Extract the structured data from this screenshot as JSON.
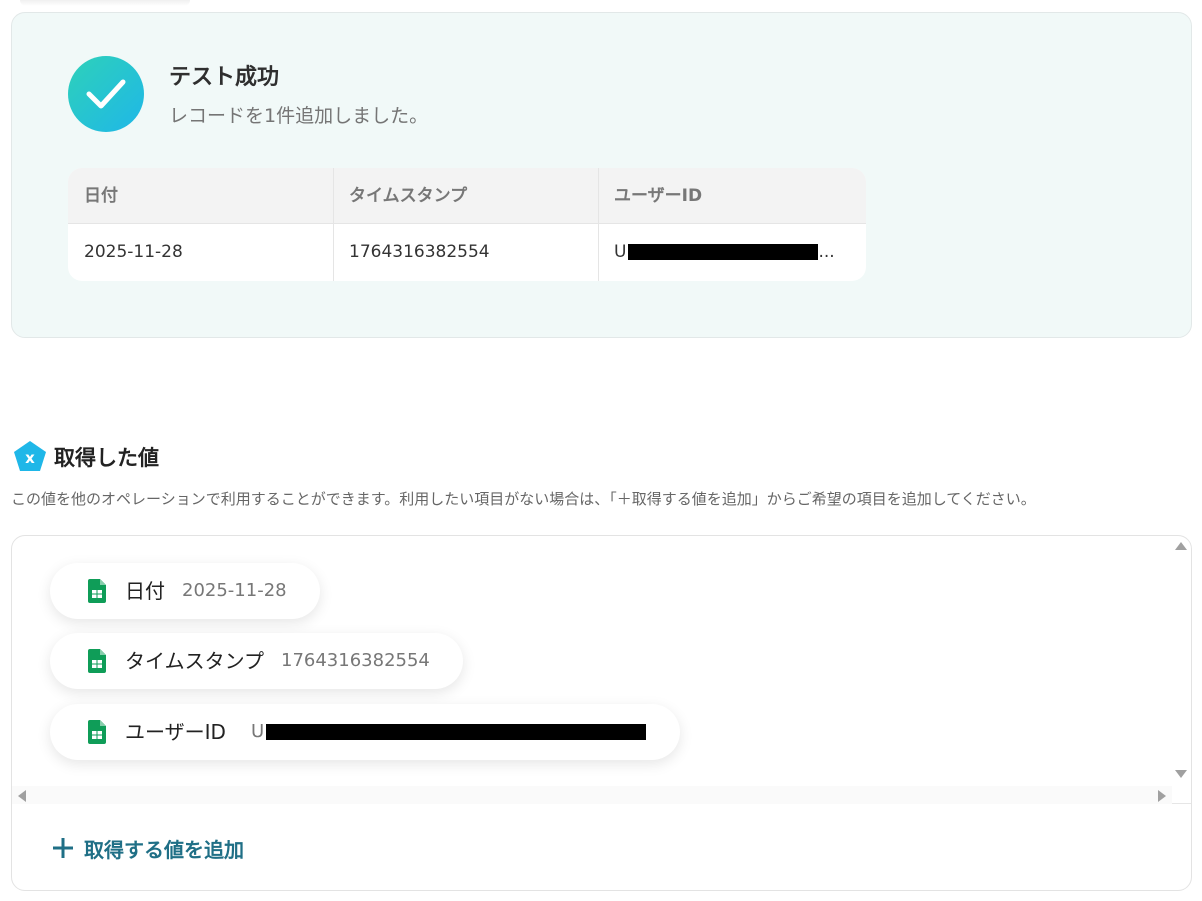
{
  "result": {
    "title": "テスト成功",
    "message": "レコードを1件追加しました。",
    "table": {
      "headers": [
        "日付",
        "タイムスタンプ",
        "ユーザーID"
      ],
      "rows": [
        [
          "2025-11-28",
          "1764316382554",
          "U"
        ]
      ],
      "truncation": "..."
    }
  },
  "section": {
    "title": "取得した値",
    "description": "この値を他のオペレーションで利用することができます。利用したい項目がない場合は、「＋取得する値を追加」からご希望の項目を追加してください。",
    "icon": "x-pentagon-icon"
  },
  "values": [
    {
      "name": "日付",
      "value": "2025-11-28",
      "icon": "google-sheets-icon"
    },
    {
      "name": "タイムスタンプ",
      "value": "1764316382554",
      "icon": "google-sheets-icon"
    },
    {
      "name": "ユーザーID",
      "value": "U",
      "icon": "google-sheets-icon"
    }
  ],
  "add_button": {
    "label": "取得する値を追加"
  },
  "colors": {
    "success_gradient_start": "#2ed1b9",
    "success_gradient_end": "#1fb7e8",
    "card_background": "#f1f9f8",
    "accent_text": "#1f6f86",
    "sheets_green": "#0f9d58",
    "section_icon": "#1fb7e8"
  }
}
